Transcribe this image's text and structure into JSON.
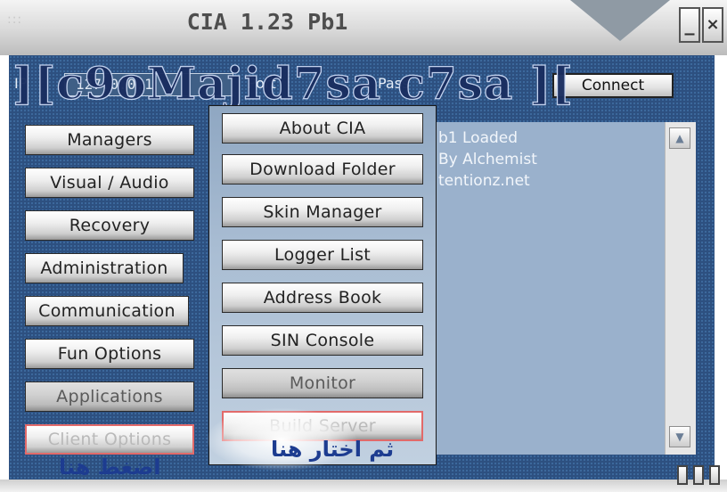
{
  "window": {
    "title": "CIA 1.23 Pb1"
  },
  "titlebar": {
    "minimize_label": "_",
    "close_label": "×"
  },
  "connection": {
    "ip_label": "IP",
    "ip_value": "127.0.0.1",
    "port_label": "Port",
    "pass_label": "Pass",
    "connect_label": "Connect",
    "watermark": "][c9oMajid7sa c7sa ]["
  },
  "left_menu": [
    {
      "label": "Managers"
    },
    {
      "label": "Visual / Audio"
    },
    {
      "label": "Recovery"
    },
    {
      "label": "Administration"
    },
    {
      "label": "Communication"
    },
    {
      "label": "Fun Options"
    },
    {
      "label": "Applications"
    },
    {
      "label": "Client Options"
    }
  ],
  "popup_menu": [
    {
      "label": "About CIA"
    },
    {
      "label": "Download Folder"
    },
    {
      "label": "Skin Manager"
    },
    {
      "label": "Logger List"
    },
    {
      "label": "Address Book"
    },
    {
      "label": "SIN Console"
    },
    {
      "label": "Monitor"
    },
    {
      "label": "Build Server"
    }
  ],
  "log": {
    "lines": [
      "b1 Loaded",
      "By Alchemist",
      "tentionz.net"
    ]
  },
  "annotations": {
    "left_arabic": "اضغط هنا",
    "right_arabic": "ثم اختار هنا"
  },
  "colors": {
    "panel_blue": "#2d5080",
    "disabled_border": "#e26a6a",
    "arabic_text": "#1d3c90"
  }
}
